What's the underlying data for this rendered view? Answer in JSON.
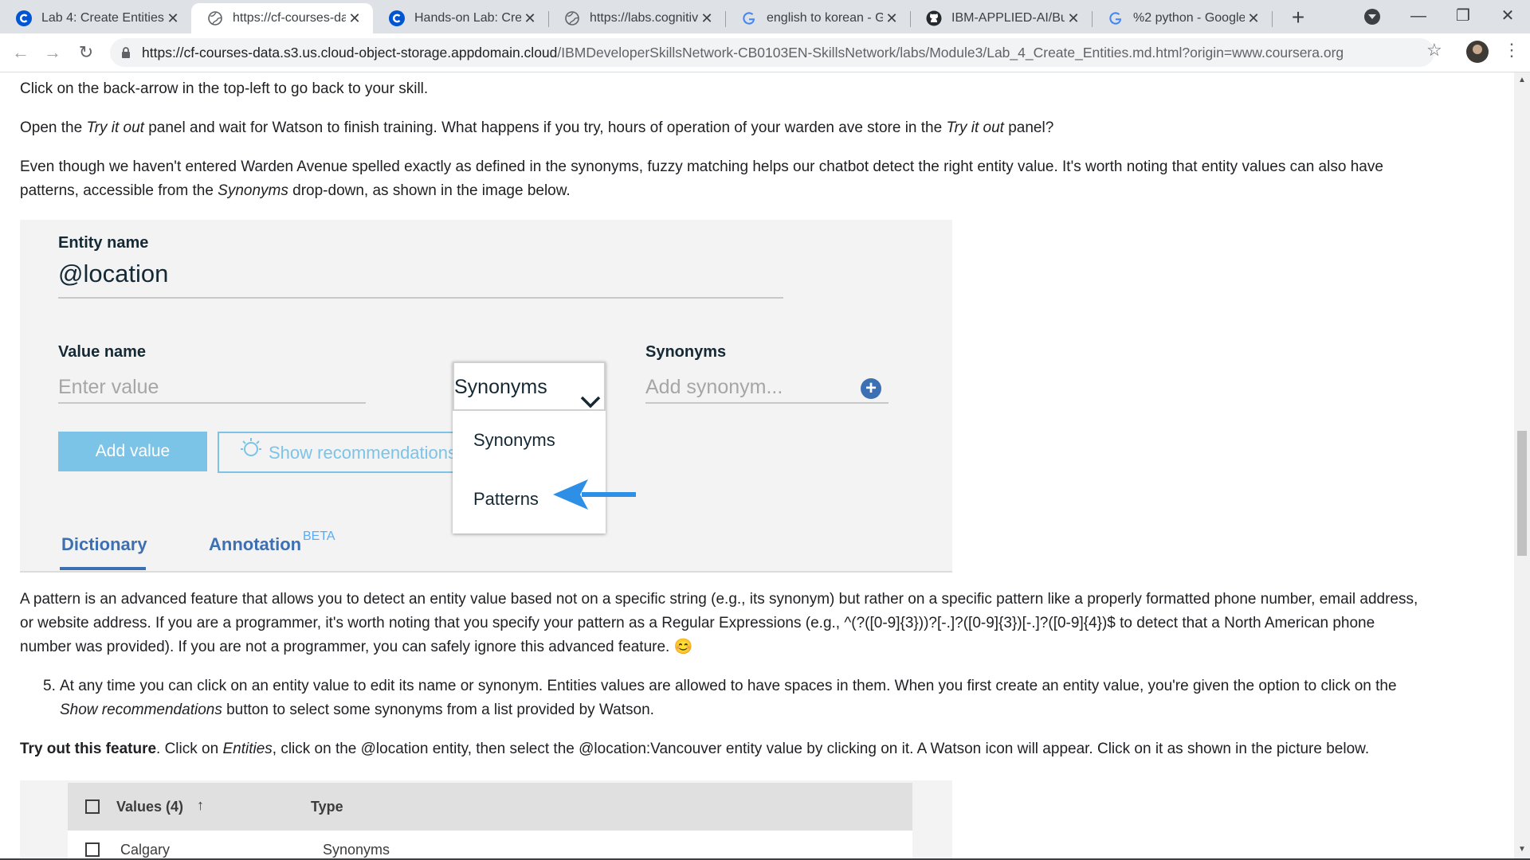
{
  "tabs": [
    {
      "title": "Lab 4: Create Entities",
      "favicon": "coursera-icon",
      "active": false
    },
    {
      "title": "https://cf-courses-da",
      "favicon": "globe-icon",
      "active": true
    },
    {
      "title": "Hands-on Lab: Creati",
      "favicon": "coursera-icon",
      "active": false
    },
    {
      "title": "https://labs.cognitive",
      "favicon": "globe-icon",
      "active": false
    },
    {
      "title": "english to korean - G",
      "favicon": "google-icon",
      "active": false
    },
    {
      "title": "IBM-APPLIED-AI/Buil",
      "favicon": "github-icon",
      "active": false
    },
    {
      "title": "%2 python - Google",
      "favicon": "google-icon",
      "active": false
    }
  ],
  "toolbar": {
    "url_host": "https://cf-courses-data.s3.us.cloud-object-storage.appdomain.cloud",
    "url_path": "/IBMDeveloperSkillsNetwork-CB0103EN-SkillsNetwork/labs/Module3/Lab_4_Create_Entities.md.html?origin=www.coursera.org"
  },
  "content": {
    "p1": "Click on the back-arrow in the top-left to go back to your skill.",
    "p2_a": "Open the ",
    "p2_i1": "Try it out",
    "p2_b": " panel and wait for Watson to finish training. What happens if you try, hours of operation of your warden ave store in the ",
    "p2_i2": "Try it out",
    "p2_c": " panel?",
    "p3_line1": "Even though we haven't entered Warden Avenue spelled exactly as defined in the synonyms, fuzzy matching helps our chatbot detect the right entity value. It's worth noting that entity values can also have",
    "p3_line2_a": "patterns, accessible from the ",
    "p3_line2_i": "Synonyms",
    "p3_line2_b": " drop-down, as shown in the image below.",
    "p4_line1": "A pattern is an advanced feature that allows you to detect an entity value based not on a specific string (e.g., its synonym) but rather on a specific pattern like a properly formatted phone number, email address,",
    "p4_line2": "or website address. If you are a programmer, it's worth noting that you specify your pattern as a Regular Expressions (e.g., ^(?([0-9]{3}))?[-.]?([0-9]{3})[-.]?([0-9]{4})$ to detect that a North American phone",
    "p4_line3": "number was provided). If you are not a programmer, you can safely ignore this advanced feature. 😊",
    "li5_num": "5.",
    "li5_line1": "At any time you can click on an entity value to edit its name or synonym. Entities values are allowed to have spaces in them. When you first create an entity value, you're given the option to click on the",
    "li5_line2_i": "Show recommendations",
    "li5_line2_b": " button to select some synonyms from a list provided by Watson.",
    "p6_bold": "Try out this feature",
    "p6_a": ". Click on ",
    "p6_i": "Entities",
    "p6_b": ", click on the @location entity, then select the @location:Vancouver entity value by clicking on it. A Watson icon will appear. Click on it as shown in the picture below."
  },
  "image1": {
    "entity_name_label": "Entity name",
    "entity_name_value": "@location",
    "value_name_label": "Value name",
    "value_placeholder": "Enter value",
    "dropdown_selected": "Synonyms",
    "dropdown_options": [
      "Synonyms",
      "Patterns"
    ],
    "synonyms_label": "Synonyms",
    "synonym_placeholder": "Add synonym...",
    "add_value": "Add value",
    "show_recommendations": "Show recommendations",
    "tab_dictionary": "Dictionary",
    "tab_annotation": "Annotation",
    "beta": "BETA",
    "arrow_color": "#2d8fe6"
  },
  "image2": {
    "col_values": "Values (4)",
    "col_type": "Type",
    "row1_value": "Calgary",
    "row1_type": "Synonyms"
  }
}
